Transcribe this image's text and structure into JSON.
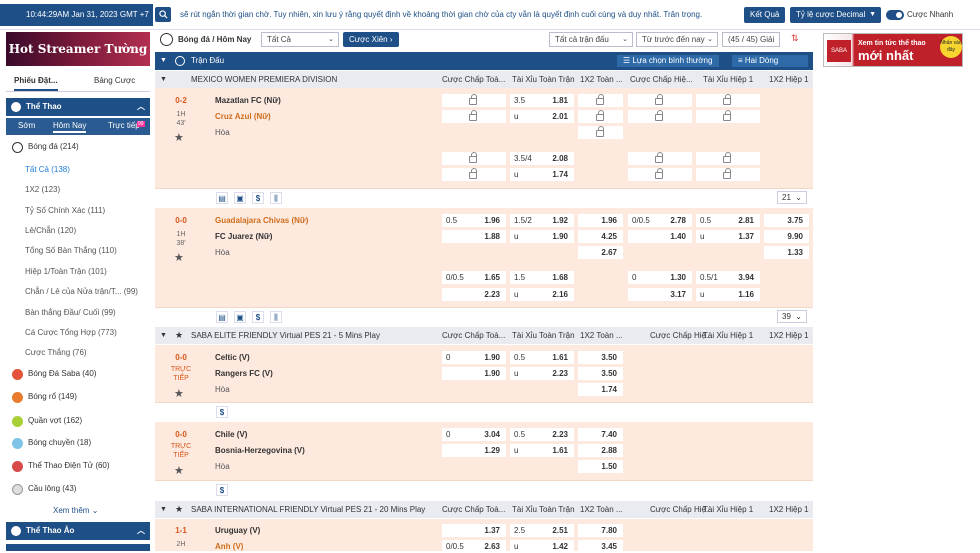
{
  "topbar": {
    "clock": "10:44:29AM Jan 31, 2023 GMT +7",
    "marquee": "sẽ rút ngắn thời gian chờ. Tuy nhiên, xin lưu ý rằng quyết định về khoảng thời gian chờ của cty vẫn là quyết định cuối cùng và duy nhất. Trân trọng.",
    "results_btn": "Kết Quả",
    "odds_format": "Tỷ lệ cược Decimal",
    "quick_bet": "Cược Nhanh"
  },
  "left": {
    "banner": "Hot Streamer Tường Thuật",
    "tabs": [
      "Phiếu Đặt...",
      "Bảng Cược"
    ],
    "sports_head": "Thể Thao",
    "time_tabs": [
      "Sớm",
      "Hôm Nay",
      "Trực tiếp"
    ],
    "new_badge": "99",
    "football": "Bóng đá (214)",
    "sub_items": [
      "Tất Cả (138)",
      "1X2 (123)",
      "Tỷ Số Chính Xác (111)",
      "Lẻ/Chẵn (120)",
      "Tổng Số Bàn Thắng (110)",
      "Hiệp 1/Toàn Trận (101)",
      "Chẵn / Lẻ của Nửa trận/T... (99)",
      "Bàn thắng Đầu/ Cuối (99)",
      "Cá Cược Tổng Hợp (773)",
      "Cược Thắng (76)"
    ],
    "sports": [
      "Bóng Đá Saba (40)",
      "Bóng rổ (149)",
      "Quần vợt (162)",
      "Bóng chuyền (18)",
      "Thể Thao Điện Tử (60)",
      "Cầu lông (43)"
    ],
    "see_more": "Xem thêm",
    "virtual_head": "Thể Thao Ảo"
  },
  "filter": {
    "title": "Bóng đá / Hôm Nay",
    "all": "Tất Cả",
    "parlay": "Cược Xiên",
    "all_matches": "Tất cả trận đấu",
    "sort": "Từ trước đến nay",
    "count": "(45 / 45) Giải"
  },
  "header": {
    "matches": "Trận Đấu",
    "option": "Lựa chọn bình thường",
    "line": "Hai Dòng"
  },
  "columns": [
    "Cược Chấp Toà...",
    "Tài Xỉu Toàn Trận",
    "1X2 Toàn ...",
    "Cược Chấp Hiệ...",
    "Tài Xỉu Hiệp 1",
    "1X2 Hiệp 1"
  ],
  "leagues": [
    {
      "name": "MEXICO WOMEN PREMIERA DIVISION",
      "matches": [
        {
          "score": "0-2",
          "time": "1H",
          "clock": "43'",
          "home": "Mazatlan FC (Nữ)",
          "away": "Cruz Azul (Nữ)",
          "draw": "Hòa",
          "r1": [
            "",
            "",
            "3.5",
            "1.81"
          ],
          "r2": [
            "",
            "",
            "u",
            "2.01"
          ],
          "r3": [
            "",
            "",
            "3.5/4",
            "2.08"
          ],
          "r4": [
            "",
            "",
            "u",
            "1.74"
          ],
          "more": "21"
        },
        {
          "score": "0-0",
          "time": "1H",
          "clock": "38'",
          "home": "Guadalajara Chivas (Nữ)",
          "away": "FC Juarez (Nữ)",
          "draw": "Hòa",
          "r1": [
            "0.5",
            "1.96",
            "1.5/2",
            "1.92",
            "1.96",
            "0/0.5",
            "2.78",
            "0.5",
            "2.81",
            "3.75"
          ],
          "r2": [
            "",
            "1.88",
            "u",
            "1.90",
            "4.25",
            "",
            "1.40",
            "u",
            "1.37",
            "9.90"
          ],
          "r2b": [
            "2.67",
            "1.33"
          ],
          "r3": [
            "0/0.5",
            "1.65",
            "1.5",
            "1.68",
            "0",
            "1.30",
            "0.5/1",
            "3.94"
          ],
          "r4": [
            "",
            "2.23",
            "u",
            "2.16",
            "",
            "3.17",
            "u",
            "1.16"
          ],
          "more": "39"
        }
      ]
    },
    {
      "name": "SABA ELITE FRIENDLY Virtual PES 21 - 5 Mins Play",
      "matches": [
        {
          "score": "0-0",
          "time": "TRỰC",
          "clock": "TIẾP",
          "home": "Celtic (V)",
          "away": "Rangers FC (V)",
          "draw": "Hòa",
          "r1": [
            "0",
            "1.90",
            "0.5",
            "1.61",
            "3.50"
          ],
          "r2": [
            "",
            "1.90",
            "u",
            "2.23",
            "3.50"
          ],
          "r2b": [
            "1.74"
          ]
        },
        {
          "score": "0-0",
          "time": "TRỰC",
          "clock": "TIẾP",
          "home": "Chile (V)",
          "away": "Bosnia-Herzegovina (V)",
          "draw": "Hòa",
          "r1": [
            "0",
            "3.04",
            "0.5",
            "2.23",
            "7.40"
          ],
          "r2": [
            "",
            "1.29",
            "u",
            "1.61",
            "2.88"
          ],
          "r2b": [
            "1.50"
          ]
        }
      ]
    },
    {
      "name": "SABA INTERNATIONAL FRIENDLY Virtual PES 21 - 20 Mins Play",
      "matches": [
        {
          "score": "1-1",
          "time": "2H",
          "home": "Uruguay (V)",
          "away": "Anh (V)",
          "r1": [
            "",
            "1.37",
            "2.5",
            "2.51",
            "7.80"
          ],
          "r2": [
            "0/0.5",
            "2.63",
            "u",
            "1.42",
            "3.45"
          ]
        }
      ]
    }
  ],
  "right": {
    "ad_small": "Xem tin tức thể thao",
    "ad_big": "mới nhất",
    "ad_logo": "SABA",
    "ad_badge": "Nhấn vào đây"
  },
  "colors": {
    "primary": "#1e4f86",
    "match_bg": "#fde9de",
    "favorite": "#d06e1c",
    "score": "#d9571b"
  }
}
